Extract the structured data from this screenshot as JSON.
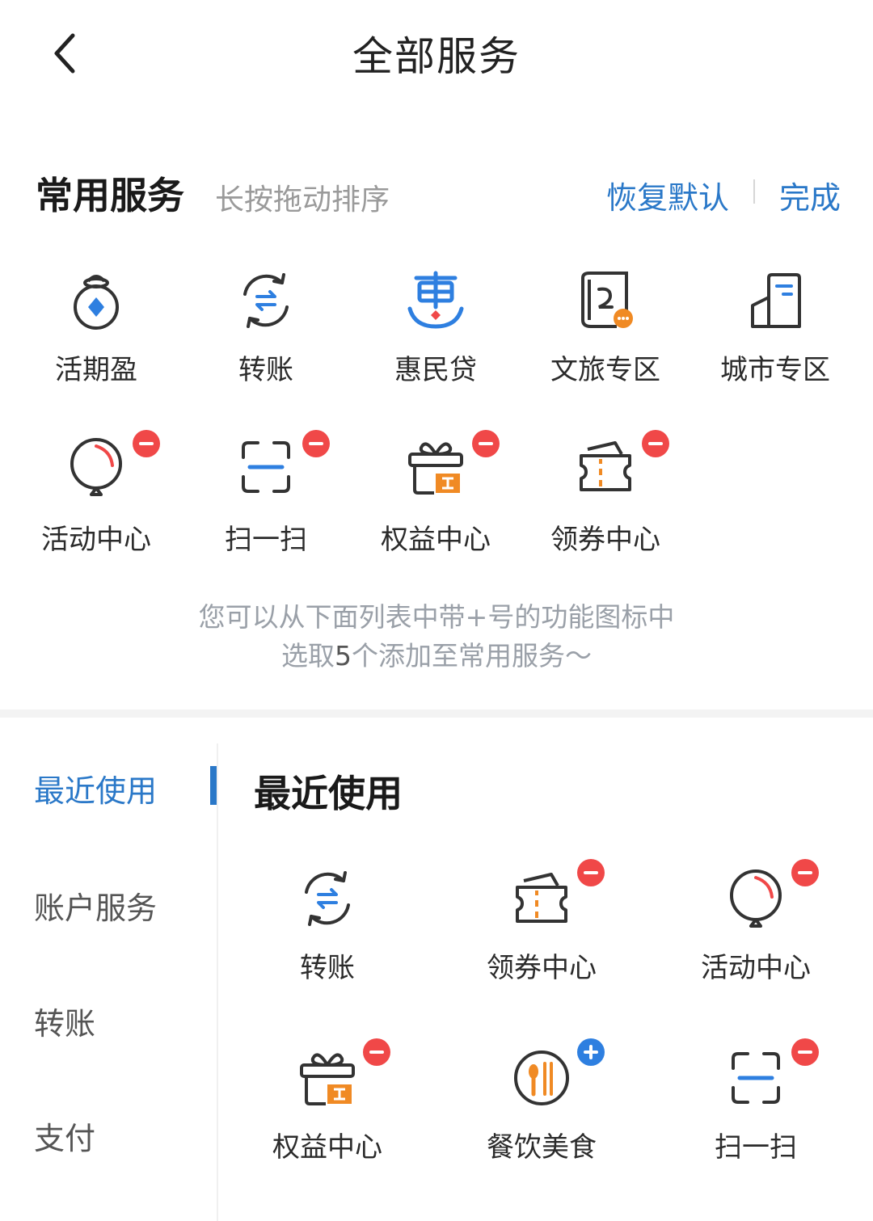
{
  "header": {
    "title": "全部服务",
    "back_icon": "chevron-left-icon"
  },
  "favorites": {
    "title": "常用服务",
    "hint": "长按拖动排序",
    "restore_label": "恢复默认",
    "done_label": "完成",
    "items": [
      {
        "label": "活期盈",
        "icon": "money-bag-icon"
      },
      {
        "label": "转账",
        "icon": "transfer-icon"
      },
      {
        "label": "惠民贷",
        "icon": "hui-loan-icon"
      },
      {
        "label": "文旅专区",
        "icon": "culture-travel-icon"
      },
      {
        "label": "城市专区",
        "icon": "city-building-icon"
      },
      {
        "label": "活动中心",
        "icon": "balloon-icon",
        "badge": "minus"
      },
      {
        "label": "扫一扫",
        "icon": "scan-icon",
        "badge": "minus"
      },
      {
        "label": "权益中心",
        "icon": "gift-box-icon",
        "badge": "minus"
      },
      {
        "label": "领券中心",
        "icon": "coupon-icon",
        "badge": "minus"
      }
    ]
  },
  "tip": {
    "line1": "您可以从下面列表中带+号的功能图标中",
    "line2_prefix": "选取",
    "line2_num": "5",
    "line2_suffix": "个添加至常用服务～"
  },
  "sidebar": {
    "items": [
      {
        "label": "最近使用",
        "active": true
      },
      {
        "label": "账户服务"
      },
      {
        "label": "转账"
      },
      {
        "label": "支付"
      }
    ]
  },
  "recent": {
    "title": "最近使用",
    "items": [
      {
        "label": "转账",
        "icon": "transfer-icon"
      },
      {
        "label": "领券中心",
        "icon": "coupon-icon",
        "badge": "minus"
      },
      {
        "label": "活动中心",
        "icon": "balloon-icon",
        "badge": "minus"
      },
      {
        "label": "权益中心",
        "icon": "gift-box-icon",
        "badge": "minus"
      },
      {
        "label": "餐饮美食",
        "icon": "dining-icon",
        "badge": "plus"
      },
      {
        "label": "扫一扫",
        "icon": "scan-icon",
        "badge": "minus"
      }
    ]
  },
  "colors": {
    "accent": "#2a78c8",
    "minus_badge": "#f04848",
    "plus_badge": "#2e7fe0",
    "icon_stroke": "#333333",
    "icon_orange": "#f08a24"
  }
}
